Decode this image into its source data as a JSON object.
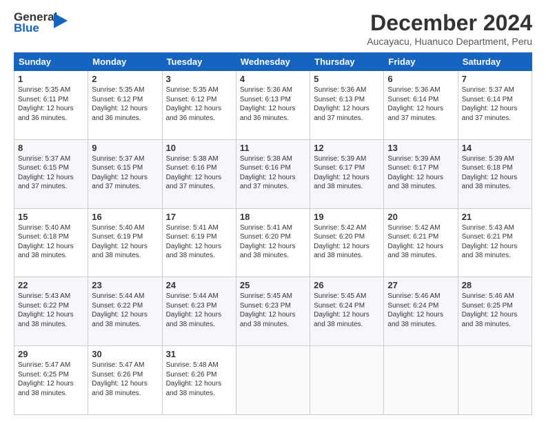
{
  "logo": {
    "line1": "General",
    "line2": "Blue"
  },
  "header": {
    "month_year": "December 2024",
    "location": "Aucayacu, Huanuco Department, Peru"
  },
  "days_of_week": [
    "Sunday",
    "Monday",
    "Tuesday",
    "Wednesday",
    "Thursday",
    "Friday",
    "Saturday"
  ],
  "weeks": [
    [
      {
        "day": "1",
        "text": "Sunrise: 5:35 AM\nSunset: 6:11 PM\nDaylight: 12 hours and 36 minutes."
      },
      {
        "day": "2",
        "text": "Sunrise: 5:35 AM\nSunset: 6:12 PM\nDaylight: 12 hours and 36 minutes."
      },
      {
        "day": "3",
        "text": "Sunrise: 5:35 AM\nSunset: 6:12 PM\nDaylight: 12 hours and 36 minutes."
      },
      {
        "day": "4",
        "text": "Sunrise: 5:36 AM\nSunset: 6:13 PM\nDaylight: 12 hours and 36 minutes."
      },
      {
        "day": "5",
        "text": "Sunrise: 5:36 AM\nSunset: 6:13 PM\nDaylight: 12 hours and 37 minutes."
      },
      {
        "day": "6",
        "text": "Sunrise: 5:36 AM\nSunset: 6:14 PM\nDaylight: 12 hours and 37 minutes."
      },
      {
        "day": "7",
        "text": "Sunrise: 5:37 AM\nSunset: 6:14 PM\nDaylight: 12 hours and 37 minutes."
      }
    ],
    [
      {
        "day": "8",
        "text": "Sunrise: 5:37 AM\nSunset: 6:15 PM\nDaylight: 12 hours and 37 minutes."
      },
      {
        "day": "9",
        "text": "Sunrise: 5:37 AM\nSunset: 6:15 PM\nDaylight: 12 hours and 37 minutes."
      },
      {
        "day": "10",
        "text": "Sunrise: 5:38 AM\nSunset: 6:16 PM\nDaylight: 12 hours and 37 minutes."
      },
      {
        "day": "11",
        "text": "Sunrise: 5:38 AM\nSunset: 6:16 PM\nDaylight: 12 hours and 37 minutes."
      },
      {
        "day": "12",
        "text": "Sunrise: 5:39 AM\nSunset: 6:17 PM\nDaylight: 12 hours and 38 minutes."
      },
      {
        "day": "13",
        "text": "Sunrise: 5:39 AM\nSunset: 6:17 PM\nDaylight: 12 hours and 38 minutes."
      },
      {
        "day": "14",
        "text": "Sunrise: 5:39 AM\nSunset: 6:18 PM\nDaylight: 12 hours and 38 minutes."
      }
    ],
    [
      {
        "day": "15",
        "text": "Sunrise: 5:40 AM\nSunset: 6:18 PM\nDaylight: 12 hours and 38 minutes."
      },
      {
        "day": "16",
        "text": "Sunrise: 5:40 AM\nSunset: 6:19 PM\nDaylight: 12 hours and 38 minutes."
      },
      {
        "day": "17",
        "text": "Sunrise: 5:41 AM\nSunset: 6:19 PM\nDaylight: 12 hours and 38 minutes."
      },
      {
        "day": "18",
        "text": "Sunrise: 5:41 AM\nSunset: 6:20 PM\nDaylight: 12 hours and 38 minutes."
      },
      {
        "day": "19",
        "text": "Sunrise: 5:42 AM\nSunset: 6:20 PM\nDaylight: 12 hours and 38 minutes."
      },
      {
        "day": "20",
        "text": "Sunrise: 5:42 AM\nSunset: 6:21 PM\nDaylight: 12 hours and 38 minutes."
      },
      {
        "day": "21",
        "text": "Sunrise: 5:43 AM\nSunset: 6:21 PM\nDaylight: 12 hours and 38 minutes."
      }
    ],
    [
      {
        "day": "22",
        "text": "Sunrise: 5:43 AM\nSunset: 6:22 PM\nDaylight: 12 hours and 38 minutes."
      },
      {
        "day": "23",
        "text": "Sunrise: 5:44 AM\nSunset: 6:22 PM\nDaylight: 12 hours and 38 minutes."
      },
      {
        "day": "24",
        "text": "Sunrise: 5:44 AM\nSunset: 6:23 PM\nDaylight: 12 hours and 38 minutes."
      },
      {
        "day": "25",
        "text": "Sunrise: 5:45 AM\nSunset: 6:23 PM\nDaylight: 12 hours and 38 minutes."
      },
      {
        "day": "26",
        "text": "Sunrise: 5:45 AM\nSunset: 6:24 PM\nDaylight: 12 hours and 38 minutes."
      },
      {
        "day": "27",
        "text": "Sunrise: 5:46 AM\nSunset: 6:24 PM\nDaylight: 12 hours and 38 minutes."
      },
      {
        "day": "28",
        "text": "Sunrise: 5:46 AM\nSunset: 6:25 PM\nDaylight: 12 hours and 38 minutes."
      }
    ],
    [
      {
        "day": "29",
        "text": "Sunrise: 5:47 AM\nSunset: 6:25 PM\nDaylight: 12 hours and 38 minutes."
      },
      {
        "day": "30",
        "text": "Sunrise: 5:47 AM\nSunset: 6:26 PM\nDaylight: 12 hours and 38 minutes."
      },
      {
        "day": "31",
        "text": "Sunrise: 5:48 AM\nSunset: 6:26 PM\nDaylight: 12 hours and 38 minutes."
      },
      {
        "day": "",
        "text": ""
      },
      {
        "day": "",
        "text": ""
      },
      {
        "day": "",
        "text": ""
      },
      {
        "day": "",
        "text": ""
      }
    ]
  ]
}
